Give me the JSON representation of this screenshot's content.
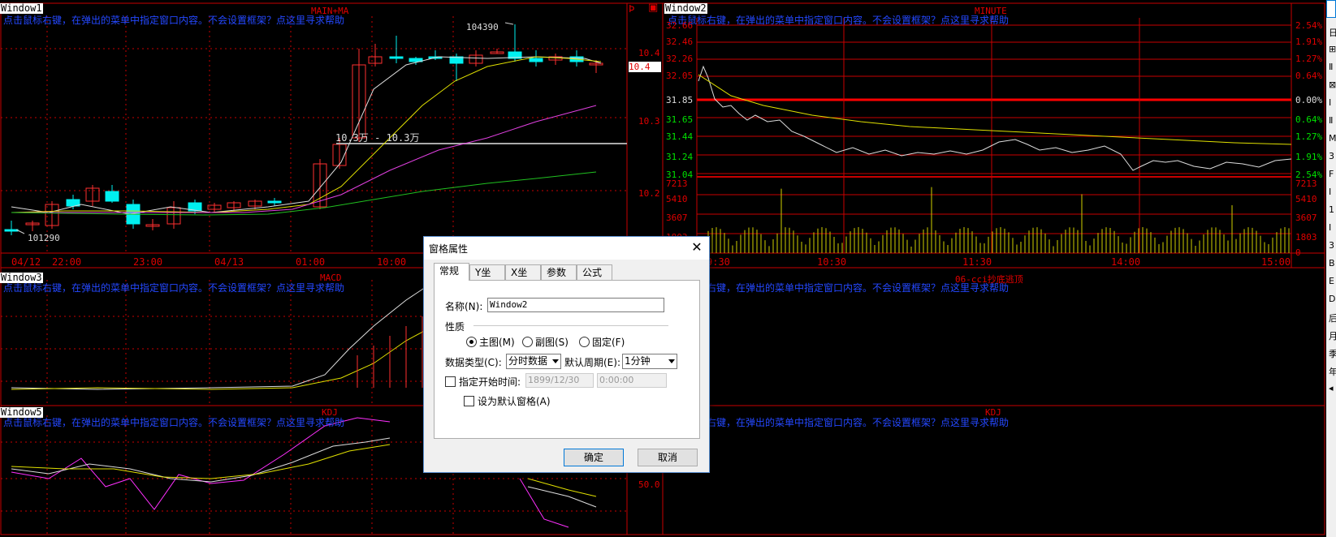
{
  "window1": {
    "label": "Window1",
    "title": "MAIN+MA",
    "hint": "点击鼠标右键，在弹出的菜单中指定窗口内容。不会设置框架？点这里寻求帮助",
    "price_high_label": "104390",
    "price_low_label": "101290",
    "hline_label": "10.3万 - 10.3万",
    "price_tag": "10.4",
    "axis": [
      "10.4",
      "10.3",
      "10.2"
    ],
    "time_labels": [
      "04/12",
      "22:00",
      "23:00",
      "04/13",
      "01:00",
      "10:00"
    ],
    "top_icons": [
      "Þ",
      "▣"
    ]
  },
  "window2": {
    "label": "Window2",
    "title": "MINUTE",
    "hint": "点击鼠标右键，在弹出的菜单中指定窗口内容。不会设置框架？点这里寻求帮助",
    "left_axis_red": [
      "32.66",
      "32.46",
      "32.26",
      "32.05"
    ],
    "left_axis_white": [
      "31.85"
    ],
    "left_axis_green": [
      "31.65",
      "31.44",
      "31.24",
      "31.04"
    ],
    "right_axis_red": [
      "2.54%",
      "1.91%",
      "1.27%",
      "0.64%"
    ],
    "right_axis_white": [
      "0.00%"
    ],
    "right_axis_green": [
      "0.64%",
      "1.27%",
      "1.91%",
      "2.54%"
    ],
    "volume_axis": [
      "7213",
      "5410",
      "3607",
      "1803",
      "0"
    ],
    "time_labels": [
      "9:30",
      "10:30",
      "11:30",
      "14:00",
      "15:00"
    ]
  },
  "window3": {
    "label": "Window3",
    "title": "MACD",
    "hint": "点击鼠标右键，在弹出的菜单中指定窗口内容。不会设置框架？点这里寻求帮助"
  },
  "window4": {
    "title": "06-cci抄底逃顶",
    "hint": "点击鼠标右键，在弹出的菜单中指定窗口内容。不会设置框架？点这里寻求帮助"
  },
  "window5": {
    "label": "Window5",
    "title": "KDJ",
    "hint": "点击鼠标右键，在弹出的菜单中指定窗口内容。不会设置框架？点这里寻求帮助",
    "axis": [
      "50.0"
    ]
  },
  "window6": {
    "title": "KDJ",
    "hint": "点击鼠标右键，在弹出的菜单中指定窗口内容。不会设置框架？点这里寻求帮助"
  },
  "dialog": {
    "title": "窗格属性",
    "close": "✕",
    "tabs": [
      "常规",
      "Y坐标",
      "X坐标",
      "参数",
      "公式"
    ],
    "name_label": "名称(N):",
    "name_value": "Window2",
    "nature_label": "性质",
    "radio_main": "主图(M)",
    "radio_sub": "副图(S)",
    "radio_fixed": "固定(F)",
    "data_type_label": "数据类型(C):",
    "data_type_value": "分时数据",
    "period_label": "默认周期(E):",
    "period_value": "1分钟",
    "start_time_label": "指定开始时间:",
    "start_date_value": "1899/12/30",
    "start_time_value": "0:00:00",
    "default_pane_label": "设为默认窗格(A)",
    "ok": "确定",
    "cancel": "取消"
  },
  "right_strip": [
    "日",
    "⊞",
    "Ⅱ",
    "⊠",
    "Ⅰ",
    "Ⅱ",
    "M",
    "3",
    "F",
    "I",
    "1",
    "I",
    "3",
    "B",
    "E",
    "D",
    "后",
    "月",
    "季",
    "年",
    "◂"
  ]
}
